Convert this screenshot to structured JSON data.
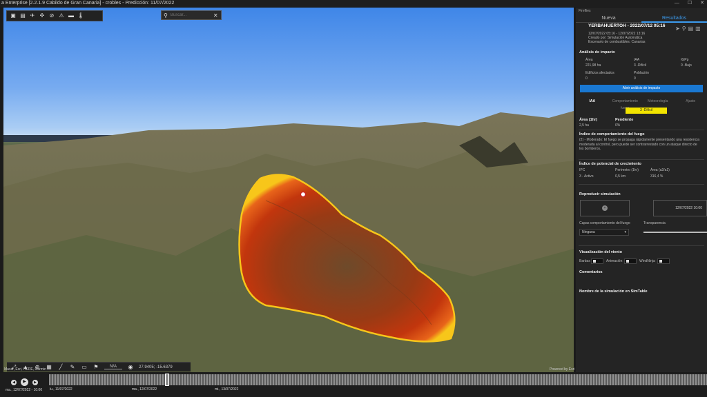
{
  "window": {
    "title": "a Enterprise [2.2.1.9 Cabildo de Gran Canaria] - crobles - Predicción: 11/07/2022",
    "controls": [
      "—",
      "☐",
      "✕"
    ]
  },
  "map": {
    "search_placeholder": "Buscar...",
    "scale_value": "N/A",
    "coordinates": "27.9405; -15.6379",
    "attribution_left": "Maxar, Esri, HERE, Garmin",
    "attribution_right": "Powered by Esri",
    "toolbar_icons": [
      "layers-icon",
      "map-icon",
      "aircraft-icon",
      "helicopter-icon",
      "no-entry-icon",
      "hazard-icon",
      "truck-icon",
      "thermometer-icon"
    ],
    "bottom_tool_icons": [
      "fullscreen-icon",
      "north-arrow-icon",
      "locate-icon",
      "table-icon",
      "measure-icon",
      "draw-icon",
      "comment-icon",
      "pin-icon",
      "location-icon"
    ]
  },
  "panel": {
    "label": "Fireflies",
    "tabs": [
      "Nueva",
      "Resultados"
    ],
    "active_tab": "Resultados",
    "sim_title": "YERBAHUERTOH - 2022/07/12 05:16",
    "sim_meta": [
      "12/07/2022 05:16 - 12/07/2022 13:16",
      "Creado por: Simulación Automática",
      "Escenario de combustibles: Canarias"
    ],
    "impact": {
      "title": "Análisis de impacto",
      "headers": [
        "Área",
        "IAA",
        "IGPp"
      ],
      "values": [
        "221,98 ha",
        "3 -Difícil",
        "0 -Bajo"
      ],
      "headers2": [
        "Edificios afectados",
        "Población"
      ],
      "values2": [
        "0",
        "0"
      ],
      "button": "Abrir análisis de impacto"
    },
    "sub_tabs": [
      "IAA",
      "Comportamiento fuego",
      "Meteorología",
      "Ajuste"
    ],
    "active_sub_tab": "IAA",
    "badge": "3 -Difícil",
    "badge_color": "#f2e400",
    "area": {
      "label": "Área (1hr)",
      "value": "2,5 ha"
    },
    "slope": {
      "label": "Pendiente",
      "value": "0%"
    },
    "behavior_title": "Índice de comportamiento del fuego",
    "behavior_text": "(2) - Moderado: El fuego se propaga rápidamente presentando una resistencia moderada al control, pero puede ser contrarrestado con un ataque directo de los bomberos.",
    "growth_title": "Índice de potencial de crecimiento",
    "growth_headers": [
      "IPC",
      "Perímetro (1hr)",
      "Área (a2/a1)"
    ],
    "growth_values": [
      "3 - Activo",
      "0,5 km",
      "316,4 %"
    ],
    "replay_title": "Reproducir simulación",
    "replay_date": "12/07/2022  10:00",
    "layers_label": "Capas comportamiento del fuego",
    "layers_value": "Ninguna",
    "transparency_label": "Transparencia",
    "wind_title": "Visualización del viento",
    "wind_options": [
      "Barbas",
      "Animación",
      "WindNinja"
    ],
    "comments_title": "Comentarios",
    "simtable_title": "Nombre de la simulación en SimTable"
  },
  "timeline": {
    "current_date": "ma., 12/07/2022 - 10:00",
    "labels": [
      "lu., 11/07/2022",
      "ma., 12/07/2022",
      "mi., 13/07/2022"
    ]
  },
  "colors": {
    "accent": "#3c9cf0",
    "button": "#1a78d2",
    "fire_core": "#b02a0c",
    "fire_edge": "#f7c61a"
  }
}
